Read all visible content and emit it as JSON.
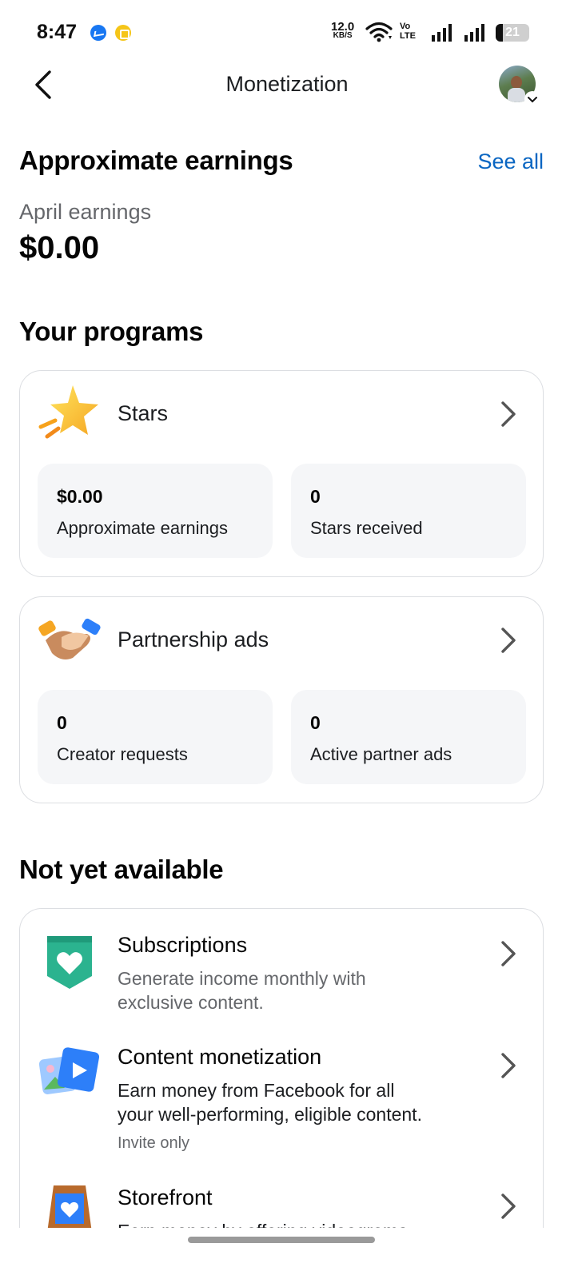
{
  "status_bar": {
    "time": "8:47",
    "net_speed_value": "12.0",
    "net_speed_unit": "KB/S",
    "volte_top": "Vo",
    "volte_bottom": "LTE",
    "battery_level": 21,
    "battery_text": "21",
    "icons": [
      "messenger-icon",
      "coin-icon",
      "wifi-icon",
      "volte-icon",
      "signal-icon",
      "signal-icon",
      "battery-icon"
    ]
  },
  "header": {
    "title": "Monetization",
    "back_icon": "chevron-left-icon",
    "avatar_dropdown_icon": "chevron-down-icon"
  },
  "earnings": {
    "title": "Approximate earnings",
    "see_all": "See all",
    "period_label": "April earnings",
    "amount": "$0.00"
  },
  "programs": {
    "title": "Your programs",
    "items": [
      {
        "title": "Stars",
        "icon": "star-icon",
        "stats": [
          {
            "value": "$0.00",
            "label": "Approximate earnings"
          },
          {
            "value": "0",
            "label": "Stars received"
          }
        ]
      },
      {
        "title": "Partnership ads",
        "icon": "handshake-icon",
        "stats": [
          {
            "value": "0",
            "label": "Creator requests"
          },
          {
            "value": "0",
            "label": "Active partner ads"
          }
        ]
      }
    ]
  },
  "not_available": {
    "title": "Not yet available",
    "items": [
      {
        "title": "Subscriptions",
        "icon": "heart-badge-icon",
        "desc_line1": "Generate income monthly with",
        "desc_line2": "exclusive content."
      },
      {
        "title": "Content monetization",
        "icon": "media-play-icon",
        "desc_line1": "Earn money from Facebook for all",
        "desc_line2": "your well-performing, eligible content.",
        "note": "Invite only"
      },
      {
        "title": "Storefront",
        "icon": "storefront-icon",
        "desc_line1": "Earn money by offering videograms"
      }
    ]
  },
  "colors": {
    "accent": "#0a66c2",
    "text_primary": "#050505",
    "text_secondary": "#65676b",
    "stat_bg": "#f5f6f8",
    "card_border": "#dcdee2"
  }
}
